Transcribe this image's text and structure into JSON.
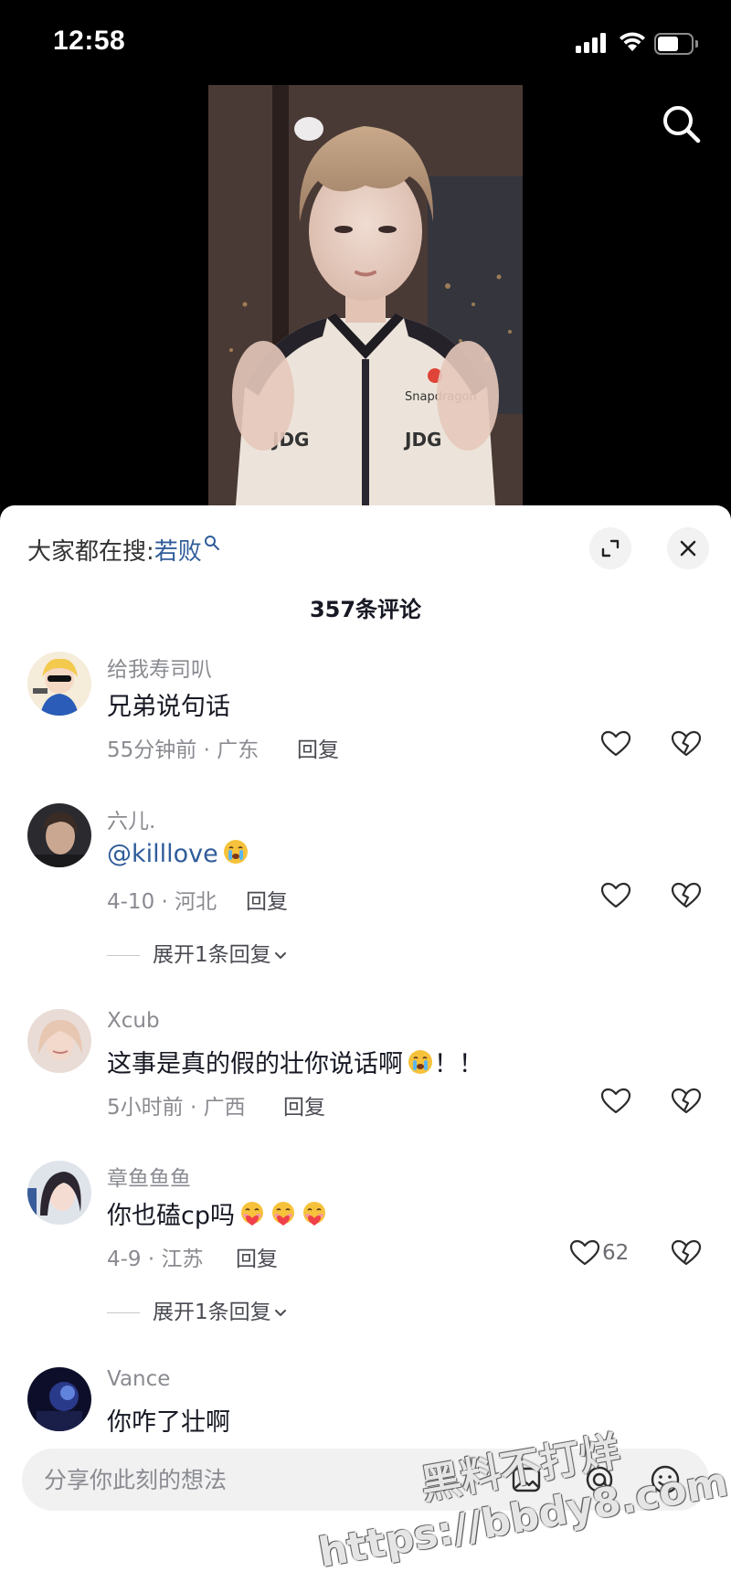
{
  "status_bar": {
    "time": "12:58"
  },
  "sheet": {
    "everyone_search_label": "大家都在搜:",
    "everyone_search_keyword": "若败",
    "comment_count_label": "357条评论"
  },
  "comments": [
    {
      "username": "给我寿司叭",
      "text": "兄弟说句话",
      "meta": "55分钟前 · 广东",
      "reply_label": "回复"
    },
    {
      "username": "六儿.",
      "mention": "@killlove",
      "meta": "4-10 · 河北",
      "reply_label": "回复",
      "expand_label": "展开1条回复"
    },
    {
      "username": "Xcub",
      "text": "这事是真的假的壮你说话啊",
      "text_suffix": "！！",
      "meta": "5小时前 · 广西",
      "reply_label": "回复"
    },
    {
      "username": "章鱼鱼鱼",
      "text": "你也磕cp吗",
      "meta": "4-9 · 江苏",
      "reply_label": "回复",
      "like_count": "62",
      "expand_label": "展开1条回复"
    },
    {
      "username": "Vance",
      "text": "你咋了壮啊"
    }
  ],
  "input_bar": {
    "placeholder": "分享你此刻的想法"
  },
  "watermark": {
    "line1": "黑料不打烊",
    "line2": "https://bbdy8.com"
  },
  "colors": {
    "link_blue": "#2f5c9a",
    "meta_gray": "#8a8b91",
    "sheet_bg": "#ffffff"
  }
}
